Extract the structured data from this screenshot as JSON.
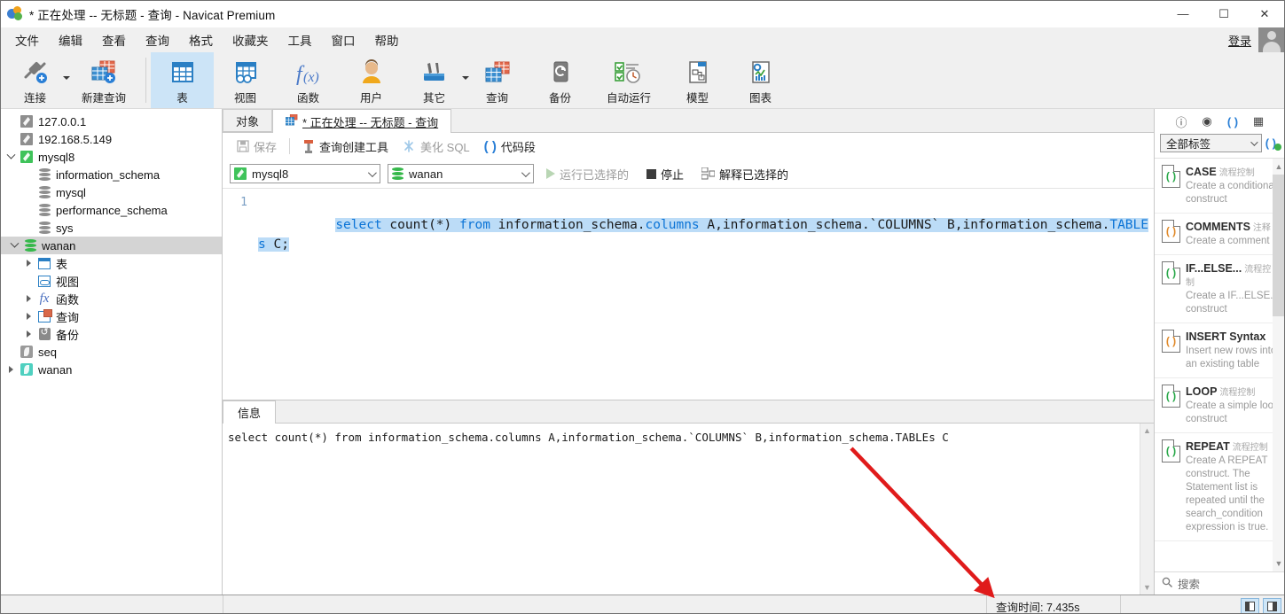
{
  "window": {
    "title": "* 正在处理 -- 无标题 - 查询 - Navicat Premium",
    "minimize": "—",
    "maximize": "☐",
    "close": "✕"
  },
  "menubar": {
    "items": [
      "文件",
      "编辑",
      "查看",
      "查询",
      "格式",
      "收藏夹",
      "工具",
      "窗口",
      "帮助"
    ],
    "login_label": "登录"
  },
  "ribbon": {
    "groups": [
      {
        "items": [
          {
            "label": "连接",
            "icon": "connection-icon",
            "has_caret": true
          },
          {
            "label": "新建查询",
            "icon": "new-query-icon",
            "has_caret": false
          }
        ]
      },
      {
        "items": [
          {
            "label": "表",
            "icon": "table-icon",
            "active": true
          },
          {
            "label": "视图",
            "icon": "view-icon",
            "active": false
          },
          {
            "label": "函数",
            "icon": "function-icon",
            "active": false
          },
          {
            "label": "用户",
            "icon": "user-icon",
            "active": false
          },
          {
            "label": "其它",
            "icon": "other-tools-icon",
            "active": false,
            "has_caret": true
          },
          {
            "label": "查询",
            "icon": "query-icon",
            "active": false
          },
          {
            "label": "备份",
            "icon": "backup-icon",
            "active": false
          },
          {
            "label": "自动运行",
            "icon": "automation-icon",
            "active": false
          },
          {
            "label": "模型",
            "icon": "model-icon",
            "active": false
          },
          {
            "label": "图表",
            "icon": "chart-icon",
            "active": false
          }
        ]
      }
    ]
  },
  "tree": {
    "nodes": [
      {
        "label": "127.0.0.1",
        "indent": 0,
        "icon": "connection-grey-icon",
        "twisty": "",
        "selected": false
      },
      {
        "label": "192.168.5.149",
        "indent": 0,
        "icon": "connection-grey-icon",
        "twisty": "",
        "selected": false
      },
      {
        "label": "mysql8",
        "indent": 0,
        "icon": "connection-green-icon",
        "twisty": "open",
        "selected": false
      },
      {
        "label": "information_schema",
        "indent": 1,
        "icon": "database-grey-icon",
        "twisty": "",
        "selected": false
      },
      {
        "label": "mysql",
        "indent": 1,
        "icon": "database-grey-icon",
        "twisty": "",
        "selected": false
      },
      {
        "label": "performance_schema",
        "indent": 1,
        "icon": "database-grey-icon",
        "twisty": "",
        "selected": false
      },
      {
        "label": "sys",
        "indent": 1,
        "icon": "database-grey-icon",
        "twisty": "",
        "selected": false
      },
      {
        "label": "wanan",
        "indent": 1,
        "icon": "database-green-icon",
        "twisty": "open",
        "selected": true
      },
      {
        "label": "表",
        "indent": 2,
        "icon": "table-icon",
        "twisty": "closed",
        "selected": false
      },
      {
        "label": "视图",
        "indent": 2,
        "icon": "view-icon",
        "twisty": "",
        "selected": false
      },
      {
        "label": "函数",
        "indent": 2,
        "icon": "function-icon",
        "twisty": "closed",
        "selected": false
      },
      {
        "label": "查询",
        "indent": 2,
        "icon": "query-icon",
        "twisty": "closed",
        "selected": false
      },
      {
        "label": "备份",
        "indent": 2,
        "icon": "backup-icon",
        "twisty": "closed",
        "selected": false
      },
      {
        "label": "seq",
        "indent": 0,
        "icon": "leaf-grey-icon",
        "twisty": "",
        "selected": false
      },
      {
        "label": "wanan",
        "indent": 0,
        "icon": "leaf-teal-icon",
        "twisty": "closed",
        "selected": false
      }
    ]
  },
  "editor_tabs": [
    {
      "label": "对象",
      "active": false,
      "icon": null
    },
    {
      "label": "* 正在处理 -- 无标题 - 查询",
      "active": true,
      "icon": "query-icon"
    }
  ],
  "query_toolbar": {
    "save": "保存",
    "query_builder": "查询创建工具",
    "beautify_sql": "美化 SQL",
    "code_snippet": "代码段"
  },
  "query_bar": {
    "connection": "mysql8",
    "database": "wanan",
    "run_selected": "运行已选择的",
    "stop": "停止",
    "explain_selected": "解释已选择的"
  },
  "editor": {
    "line_number": "1",
    "sql_segments": [
      {
        "text": "select",
        "kw": true
      },
      {
        "text": " count(*) ",
        "kw": false
      },
      {
        "text": "from",
        "kw": true
      },
      {
        "text": " information_schema.",
        "kw": false
      },
      {
        "text": "columns",
        "kw": true
      },
      {
        "text": " A,information_schema.`COLUMNS` B,information_schema.",
        "kw": false
      },
      {
        "text": "TABLEs",
        "kw": true
      },
      {
        "text": " C;",
        "kw": false
      }
    ],
    "sql_plain": "select count(*) from information_schema.columns A,information_schema.`COLUMNS` B,information_schema.TABLEs C;"
  },
  "results": {
    "tab_label": "信息",
    "message": "select count(*) from information_schema.columns A,information_schema.`COLUMNS` B,information_schema.TABLEs C"
  },
  "snippets": {
    "header_icons": [
      "info-icon",
      "eye-icon",
      "code-paren-icon",
      "grid-icon"
    ],
    "filter_value": "全部标签",
    "add_label": "( )",
    "search_placeholder": "搜索",
    "items": [
      {
        "title": "CASE",
        "tag": "流程控制",
        "desc": "Create a conditional construct",
        "color": "green"
      },
      {
        "title": "COMMENTS",
        "tag": "注释",
        "desc": "Create a comment",
        "color": "orange"
      },
      {
        "title": "IF...ELSE...",
        "tag": "流程控制",
        "desc": "Create a IF...ELSE... construct",
        "color": "green"
      },
      {
        "title": "INSERT Syntax",
        "tag": "",
        "desc": "Insert new rows into an existing table",
        "color": "orange"
      },
      {
        "title": "LOOP",
        "tag": "流程控制",
        "desc": "Create a simple loop construct",
        "color": "green"
      },
      {
        "title": "REPEAT",
        "tag": "流程控制",
        "desc": "Create A REPEAT construct. The Statement list is repeated until the search_condition expression is true.",
        "color": "green"
      }
    ]
  },
  "statusbar": {
    "query_time_label": "查询时间: 7.435s",
    "left_cell": "",
    "right_cell": ""
  },
  "colors": {
    "accent_blue": "#2a7fd6",
    "selection": "#bcdcf7",
    "keyword": "#0a73d6",
    "annotation_red": "#e01b1b",
    "ribbon_active": "#cce4f7"
  }
}
